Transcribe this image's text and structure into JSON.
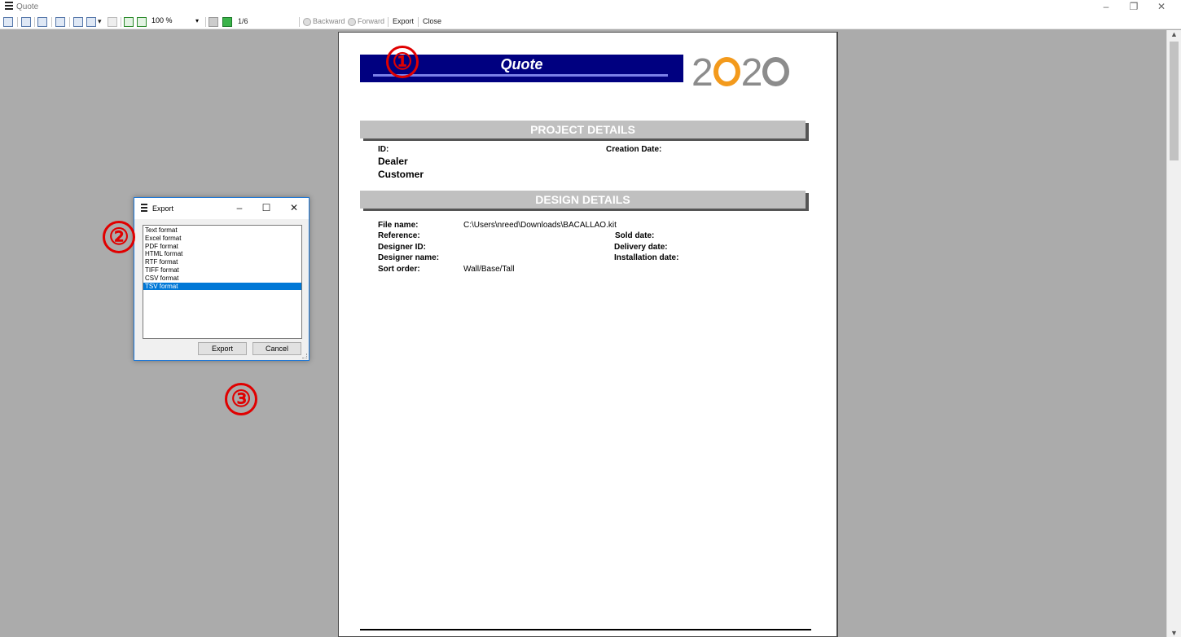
{
  "window": {
    "title": "Quote",
    "controls": [
      "–",
      "❐",
      "✕"
    ]
  },
  "toolbar": {
    "zoom": "100 %",
    "page_indicator": "1/6",
    "backward_label": "Backward",
    "forward_label": "Forward",
    "export_label": "Export",
    "close_label": "Close"
  },
  "report": {
    "quote_title": "Quote",
    "logo_left": "2",
    "logo_mid": "2",
    "project_details_header": "PROJECT DETAILS",
    "id_label": "ID:",
    "creation_date_label": "Creation Date:",
    "dealer_label": "Dealer",
    "customer_label": "Customer",
    "design_details_header": "DESIGN DETAILS",
    "file_name_label": "File name:",
    "file_name_value": "C:\\Users\\nreed\\Downloads\\BACALLAO.kit",
    "reference_label": "Reference:",
    "sold_date_label": "Sold date:",
    "designer_id_label": "Designer ID:",
    "delivery_date_label": "Delivery date:",
    "designer_name_label": "Designer name:",
    "installation_date_label": "Installation date:",
    "sort_order_label": "Sort order:",
    "sort_order_value": "Wall/Base/Tall"
  },
  "export_dialog": {
    "title": "Export",
    "formats": [
      "Text format",
      "Excel format",
      "PDF format",
      "HTML format",
      "RTF format",
      "TIFF format",
      "CSV format",
      "TSV format"
    ],
    "selected_format": "TSV format",
    "export_button": "Export",
    "cancel_button": "Cancel"
  },
  "callouts": [
    "①",
    "②",
    "③"
  ],
  "colors": {
    "banner": "#000080",
    "accent_orange": "#f39a1c",
    "callout_red": "#e00000",
    "selection": "#0078d7"
  }
}
